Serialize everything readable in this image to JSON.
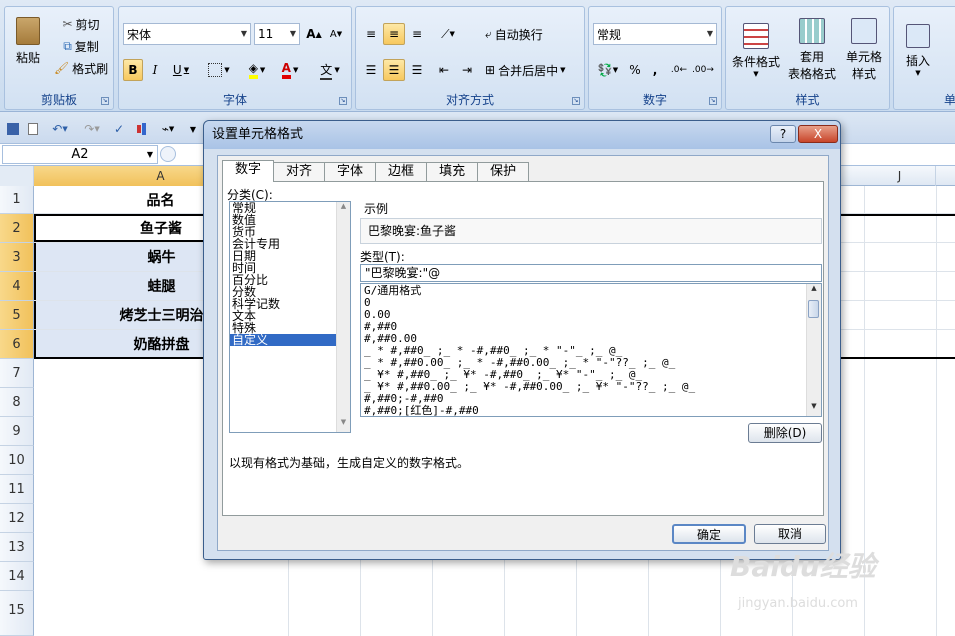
{
  "ribbon": {
    "clipboard": {
      "paste": "粘贴",
      "cut": "剪切",
      "copy": "复制",
      "format_painter": "格式刷",
      "label": "剪贴板"
    },
    "font": {
      "name": "宋体",
      "size": "11",
      "label": "字体",
      "bold": "B",
      "italic": "I",
      "underline": "U",
      "grow": "A",
      "shrink": "A",
      "color_a": "A",
      "wen": "文"
    },
    "alignment": {
      "wrap": "自动换行",
      "merge": "合并后居中",
      "label": "对齐方式"
    },
    "number": {
      "format": "常规",
      "percent": "%",
      "comma": ",",
      "label": "数字"
    },
    "styles": {
      "conditional": "条件格式",
      "table_format_1": "套用",
      "table_format_2": "表格格式",
      "cell_styles_1": "单元格",
      "cell_styles_2": "样式",
      "label": "样式"
    },
    "cells": {
      "insert": "插入",
      "label": "单"
    }
  },
  "formula_bar": {
    "name_box": "A2"
  },
  "sheet": {
    "columns": [
      "A",
      "J"
    ],
    "rows": [
      "1",
      "2",
      "3",
      "4",
      "5",
      "6",
      "7",
      "8",
      "9",
      "10",
      "11",
      "12",
      "13",
      "14",
      "15"
    ],
    "cells": [
      "品名",
      "鱼子酱",
      "蜗牛",
      "蛙腿",
      "烤芝士三明治",
      "奶酪拼盘"
    ]
  },
  "dialog": {
    "title": "设置单元格格式",
    "help": "?",
    "close": "X",
    "tabs": [
      "数字",
      "对齐",
      "字体",
      "边框",
      "填充",
      "保护"
    ],
    "category_label": "分类(C):",
    "categories": [
      "常规",
      "数值",
      "货币",
      "会计专用",
      "日期",
      "时间",
      "百分比",
      "分数",
      "科学记数",
      "文本",
      "特殊",
      "自定义"
    ],
    "sample_label": "示例",
    "sample_value": "巴黎晚宴:鱼子酱",
    "type_label": "类型(T):",
    "type_value": "\"巴黎晚宴:\"@",
    "formats": [
      "G/通用格式",
      "0",
      "0.00",
      "#,##0",
      "#,##0.00",
      "_ * #,##0_ ;_ * -#,##0_ ;_ * \"-\"_ ;_ @_",
      "_ * #,##0.00_ ;_ * -#,##0.00_ ;_ * \"-\"??_ ;_ @_",
      "_ ¥* #,##0_ ;_ ¥* -#,##0_ ;_ ¥* \"-\"_ ;_ @_",
      "_ ¥* #,##0.00_ ;_ ¥* -#,##0.00_ ;_ ¥* \"-\"??_ ;_ @_",
      "#,##0;-#,##0",
      "#,##0;[红色]-#,##0"
    ],
    "delete_button": "删除(D)",
    "description": "以现有格式为基础，生成自定义的数字格式。",
    "ok": "确定",
    "cancel": "取消"
  },
  "watermark": {
    "brand": "Baidu经验",
    "url": "jingyan.baidu.com"
  }
}
